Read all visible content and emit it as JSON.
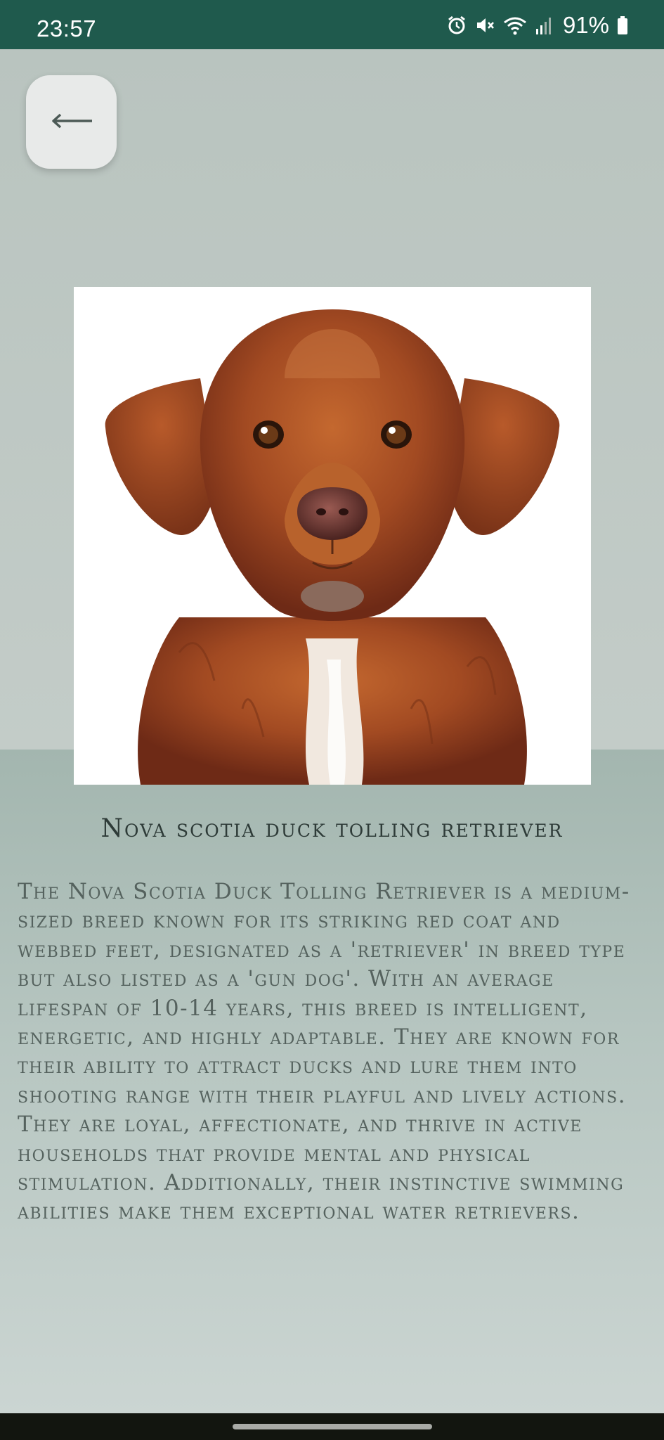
{
  "status_bar": {
    "time": "23:57",
    "battery": "91%",
    "icons": [
      "alarm-icon",
      "mute-icon",
      "wifi-icon",
      "signal-icon",
      "battery-icon"
    ]
  },
  "header": {
    "back_icon": "arrow-left-icon"
  },
  "breed": {
    "name": "Nova scotia duck tolling retriever",
    "description": "The Nova Scotia Duck Tolling Retriever is a medium-sized breed known for its striking red coat and webbed feet, designated as a 'retriever' in breed type but also listed as a 'gun dog'. With an average lifespan of 10-14 years, this breed is intelligent, energetic, and highly adaptable. They are known for their ability to attract ducks and lure them into shooting range with their playful and lively actions. They are loyal, affectionate, and thrive in active households that provide mental and physical stimulation. Additionally, their instinctive swimming abilities make them exceptional water retrievers."
  },
  "colors": {
    "status_bar": "#1f5a4d",
    "title_text": "#2e3b38",
    "body_text": "#55625e",
    "dog_coat": "#a24a22"
  }
}
